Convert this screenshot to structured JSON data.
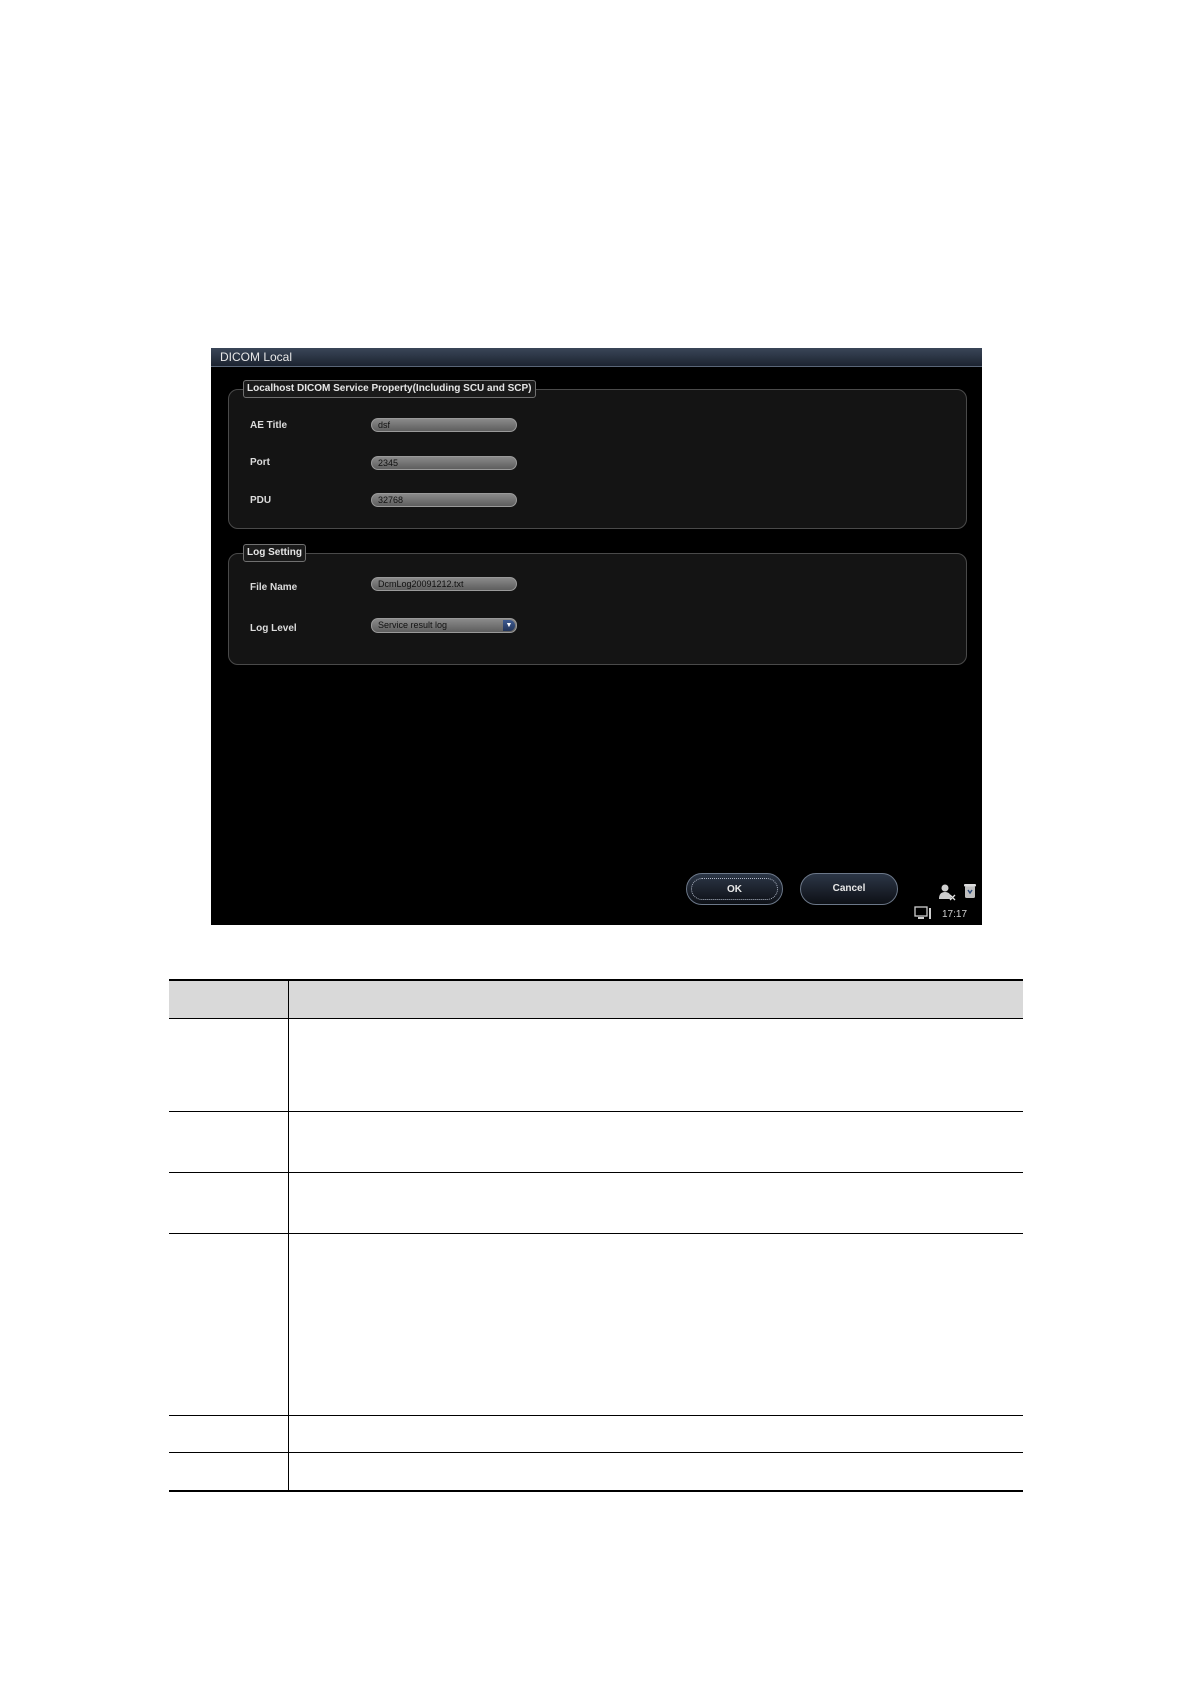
{
  "window": {
    "title": "DICOM Local"
  },
  "service_group": {
    "legend": "Localhost DICOM Service Property(Including SCU and SCP)",
    "fields": [
      {
        "label": "AE Title",
        "value": "dsf"
      },
      {
        "label": "Port",
        "value": "2345"
      },
      {
        "label": "PDU",
        "value": "32768"
      }
    ]
  },
  "log_group": {
    "legend": "Log Setting",
    "file_name_label": "File Name",
    "file_name_value": "DcmLog20091212.txt",
    "log_level_label": "Log Level",
    "log_level_value": "Service result log"
  },
  "buttons": {
    "ok": "OK",
    "cancel": "Cancel"
  },
  "status": {
    "time": "17:17",
    "icons": [
      "user-icon",
      "recycle-bin-icon",
      "monitor-icon"
    ]
  },
  "colors": {
    "window_bg": "#000000",
    "title_bar": "#2a3444",
    "header_row": "#d9d9d9"
  }
}
